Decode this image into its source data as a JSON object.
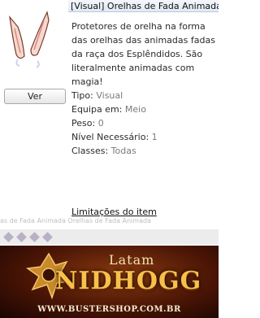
{
  "item": {
    "title": "[Visual] Orelhas de Fada Animada",
    "view_label": "Ver",
    "description": "Protetores de orelha na forma das orelhas das animadas fadas da raça dos Esplêndidos. São literalmente animadas com magia!",
    "properties": [
      {
        "label": "Tipo:",
        "value": "Visual"
      },
      {
        "label": "Equipa em:",
        "value": "Meio"
      },
      {
        "label": "Peso:",
        "value": "0"
      },
      {
        "label": "Nível Necessário:",
        "value": "1"
      },
      {
        "label": "Classes:",
        "value": "Todas"
      }
    ],
    "limits_link": "Limitações do item"
  },
  "background_strip": "as de Fada Animada   Orelhas de Fada Animada",
  "banner": {
    "top": "Latam",
    "title": "NIDHOGG",
    "url": "WWW.BUSTERSHOP.COM.BR"
  },
  "colors": {
    "value_gray": "#7a7a7a",
    "banner_gold": "#f7c04a"
  }
}
